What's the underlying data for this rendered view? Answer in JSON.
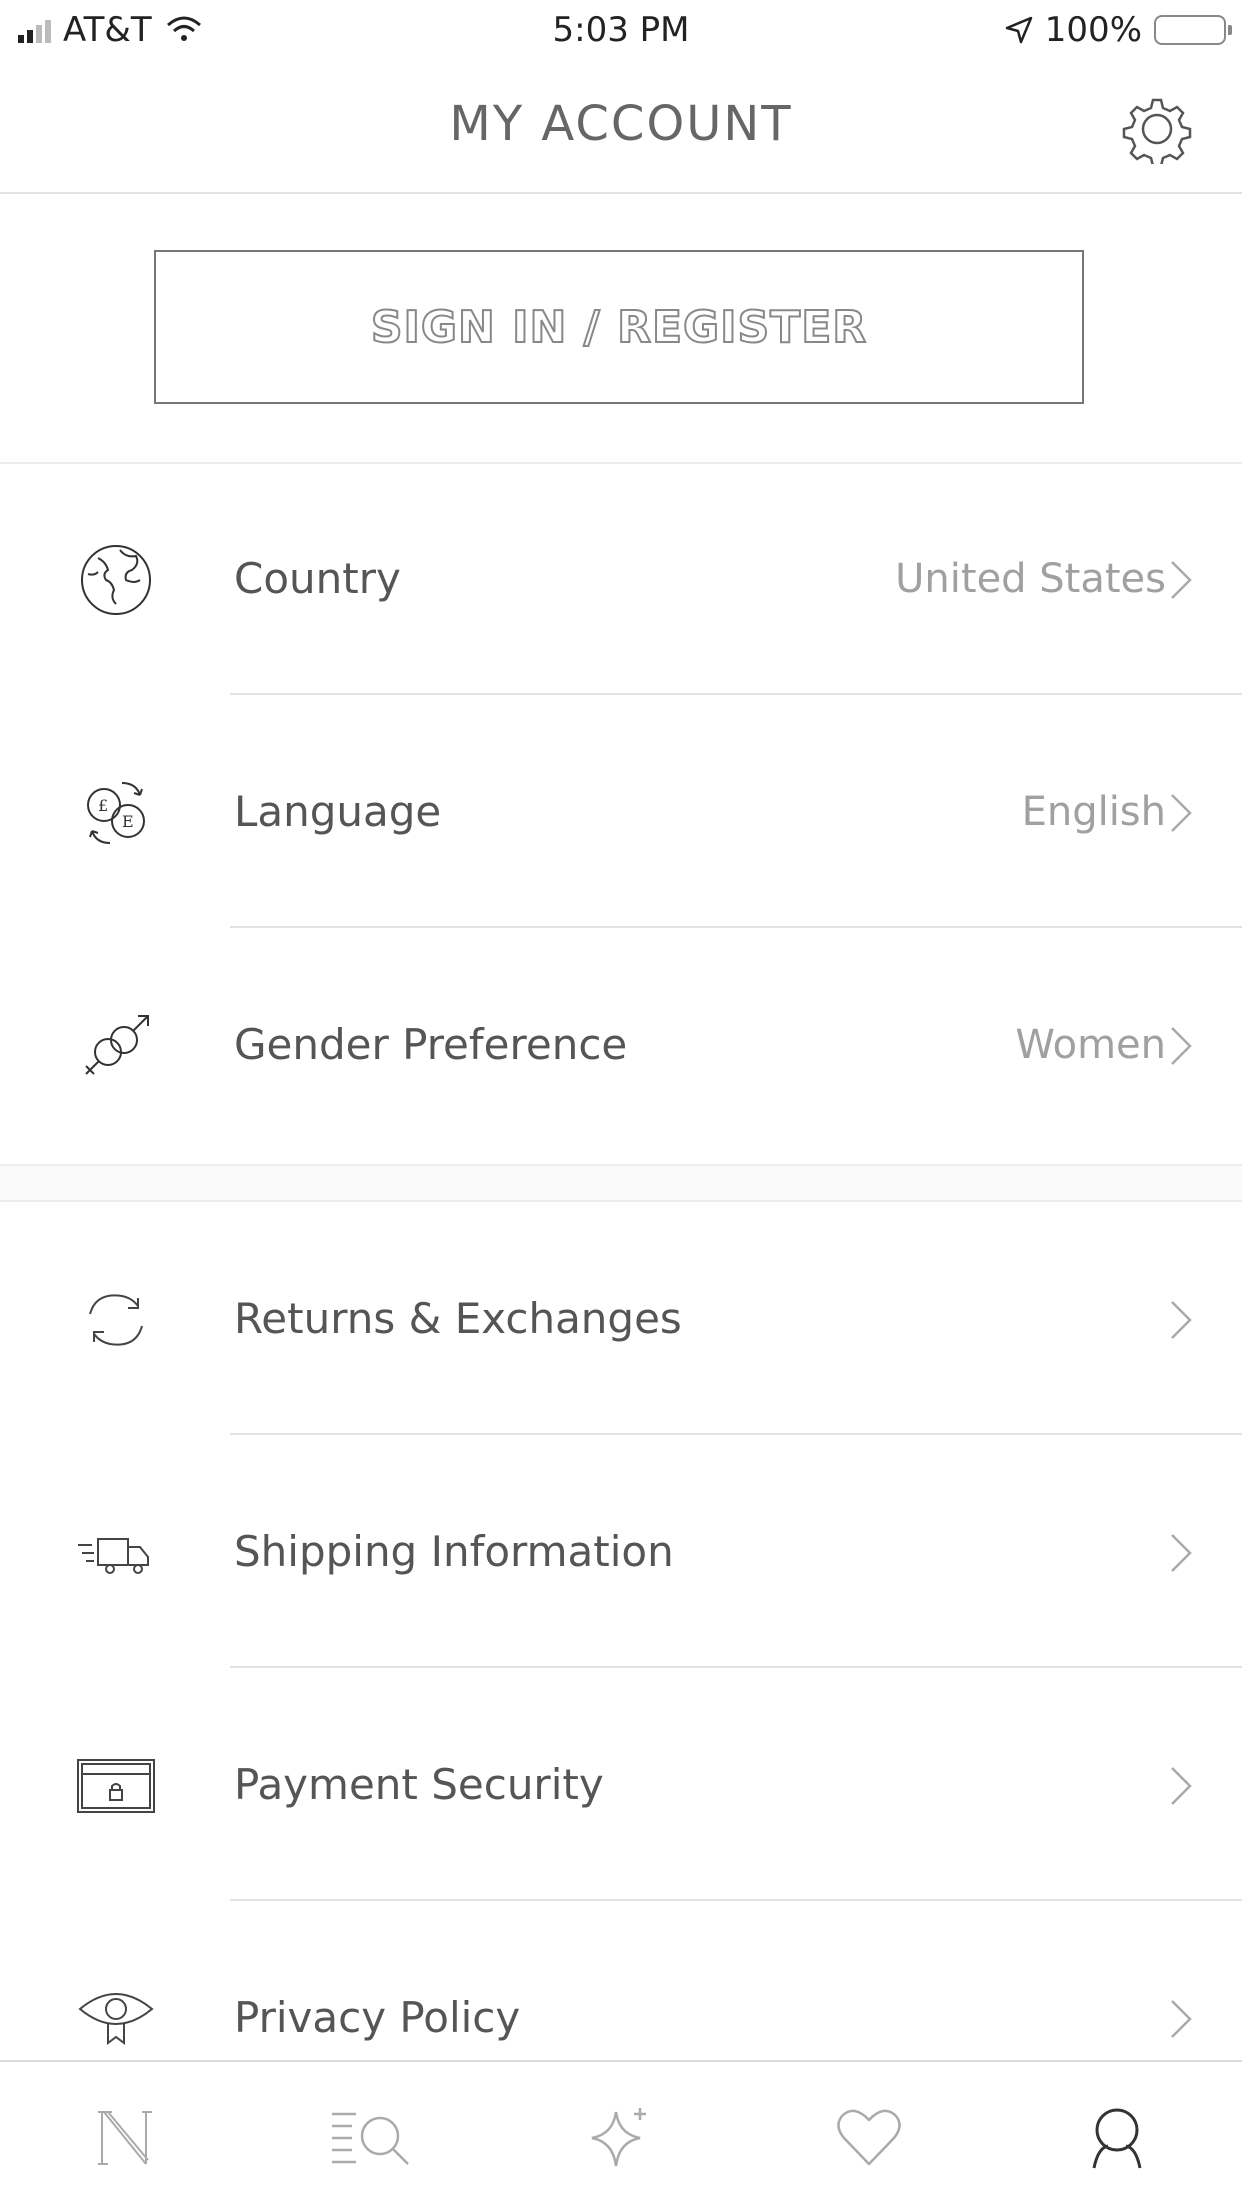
{
  "status_bar": {
    "carrier": "AT&T",
    "time": "5:03 PM",
    "battery": "100%"
  },
  "header": {
    "title": "MY ACCOUNT",
    "settings_icon": "gear-icon"
  },
  "signin": {
    "label": "SIGN IN / REGISTER"
  },
  "preferences": [
    {
      "label": "Country",
      "value": "United States",
      "icon": "globe-icon"
    },
    {
      "label": "Language",
      "value": "English",
      "icon": "currency-exchange-icon"
    },
    {
      "label": "Gender Preference",
      "value": "Women",
      "icon": "gender-icon"
    }
  ],
  "info": [
    {
      "label": "Returns & Exchanges",
      "icon": "returns-icon"
    },
    {
      "label": "Shipping Information",
      "icon": "truck-icon"
    },
    {
      "label": "Payment Security",
      "icon": "card-lock-icon"
    },
    {
      "label": "Privacy Policy",
      "icon": "eye-icon"
    }
  ],
  "tab_bar": {
    "tabs": [
      {
        "name": "home",
        "icon": "n-logo-icon"
      },
      {
        "name": "search",
        "icon": "search-icon"
      },
      {
        "name": "discover",
        "icon": "sparkle-icon"
      },
      {
        "name": "wishlist",
        "icon": "heart-icon"
      },
      {
        "name": "account",
        "icon": "user-icon"
      }
    ]
  },
  "colors": {
    "text": "#555555",
    "muted": "#a0a0a0",
    "separator": "#e3e3e3"
  }
}
